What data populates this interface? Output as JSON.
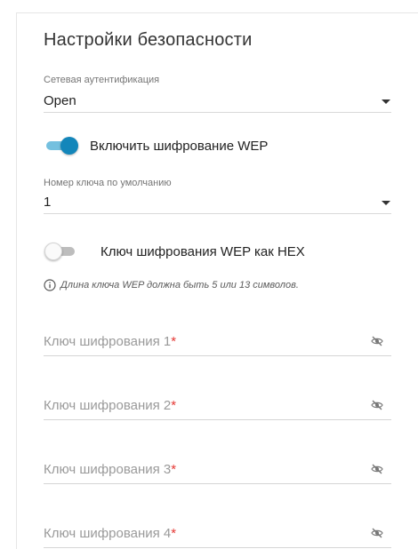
{
  "title": "Настройки безопасности",
  "auth": {
    "label": "Сетевая аутентификация",
    "value": "Open"
  },
  "wep_toggle": {
    "label": "Включить шифрование WEP",
    "on": true
  },
  "default_key": {
    "label": "Номер ключа по умолчанию",
    "value": "1"
  },
  "hex_toggle": {
    "label": "Ключ шифрования WEP как HEX",
    "on": false
  },
  "hint": "Длина ключа WEP должна быть 5 или 13 символов.",
  "keys": [
    {
      "placeholder": "Ключ шифрования 1",
      "required": "*"
    },
    {
      "placeholder": "Ключ шифрования 2",
      "required": "*"
    },
    {
      "placeholder": "Ключ шифрования 3",
      "required": "*"
    },
    {
      "placeholder": "Ключ шифрования 4",
      "required": "*"
    }
  ],
  "colors": {
    "accent": "#1386ba",
    "accent_track": "#74c0df",
    "required": "#e53935"
  },
  "icons": {
    "hint": "info-icon",
    "field_toggle": "eye-off-icon",
    "select": "caret-down-icon"
  }
}
